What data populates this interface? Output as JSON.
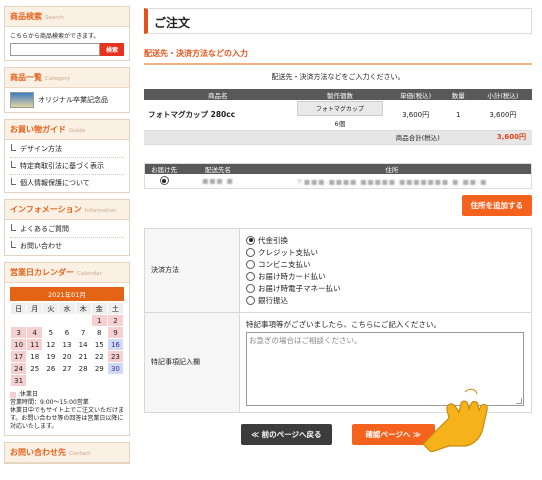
{
  "sidebar": {
    "search": {
      "title": "商品検索",
      "title_en": "Search",
      "desc": "こちらから商品検索ができます。",
      "input_value": "",
      "button": "検索"
    },
    "category": {
      "title": "商品一覧",
      "title_en": "Category",
      "item": "オリジナル卒業記念品"
    },
    "guide": {
      "title": "お買い物ガイド",
      "title_en": "Guide",
      "items": [
        "デザイン方法",
        "特定商取引法に基づく表示",
        "個人情報保護について"
      ]
    },
    "info": {
      "title": "インフォメーション",
      "title_en": "Information",
      "items": [
        "よくあるご質問",
        "お問い合わせ"
      ]
    },
    "calendar": {
      "title": "営業日カレンダー",
      "title_en": "Calendar",
      "month": "2021年01月",
      "dow": [
        "日",
        "月",
        "火",
        "水",
        "木",
        "金",
        "土"
      ],
      "rows": [
        [
          "",
          "",
          "",
          "",
          "",
          "1",
          "2"
        ],
        [
          "3",
          "4",
          "5",
          "6",
          "7",
          "8",
          "9"
        ],
        [
          "10",
          "11",
          "12",
          "13",
          "14",
          "15",
          "16"
        ],
        [
          "17",
          "18",
          "19",
          "20",
          "21",
          "22",
          "23"
        ],
        [
          "24",
          "25",
          "26",
          "27",
          "28",
          "29",
          "30"
        ],
        [
          "31",
          "",
          "",
          "",
          "",
          "",
          ""
        ]
      ],
      "legend1": ":休業日",
      "legend2": "営業時間：9:00〜15:00営業",
      "legend3": "休業日中でもサイト上でご注文いただけます。お問い合わせ等の回答は営業日以降に対応いたします。"
    },
    "contact": {
      "title": "お問い合わせ先",
      "title_en": "Contact"
    }
  },
  "main": {
    "title": "ご注文",
    "section": "配送先・決済方法などの入力",
    "intro": "配送先・決済方法などをご入力ください。",
    "product_table": {
      "headers": [
        "商品名",
        "製作個数",
        "単価(税込)",
        "数量",
        "小計(税込)"
      ],
      "product": "フォトマグカップ 280cc",
      "qty_label": "フォトマグカップ",
      "qty_count": "6個",
      "unit_price": "3,600円",
      "quantity": "1",
      "subtotal": "3,600円",
      "total_label": "商品合計(税込)",
      "total": "3,600円"
    },
    "delivery_table": {
      "headers": [
        "お届け先",
        "配送先名",
        "住所"
      ],
      "name": "■■■ ■",
      "address": "〒■■■-■■■■ ■■■■■ ■■■■■■■ ■-■■-■"
    },
    "add_address_button": "住所を追加する",
    "payment": {
      "label": "決済方法",
      "options": [
        "代金引換",
        "クレジット支払い",
        "コンビニ支払い",
        "お届け時カード払い",
        "お届け時電子マネー払い",
        "銀行振込"
      ],
      "selected_index": 0
    },
    "remarks": {
      "label": "特記事項記入欄",
      "note": "特記事項等がございましたら、こちらにご記入ください。",
      "placeholder": "お急ぎの場合はご相談ください。"
    },
    "back_button": "≪ 前のページへ戻る",
    "next_button": "確認ページへ ≫"
  },
  "colors": {
    "accent": "#e5531a",
    "orange_button": "#f4621e",
    "dark_button": "#3c3c3c",
    "header_gray": "#595959"
  }
}
